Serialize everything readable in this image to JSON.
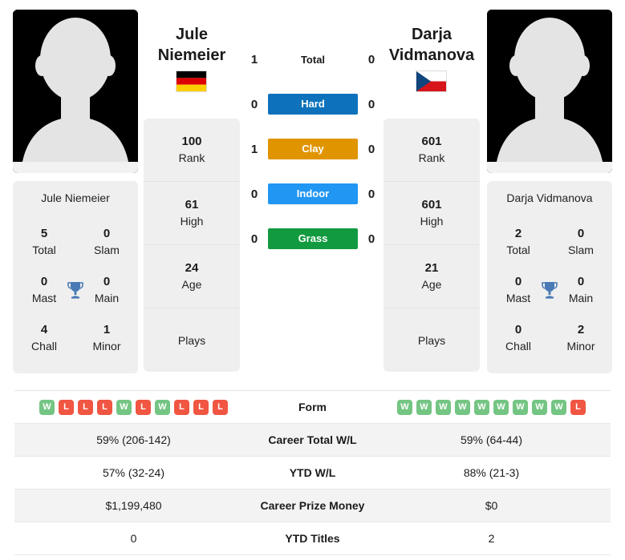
{
  "players": {
    "left": {
      "first_name": "Jule",
      "last_name": "Niemeier",
      "full_name": "Jule Niemeier",
      "country": "Germany",
      "flag_icon": "flag-germany-icon",
      "avatar_icon": "avatar-placeholder-icon",
      "rank": "100",
      "rank_label": "Rank",
      "high": "61",
      "high_label": "High",
      "age": "24",
      "age_label": "Age",
      "plays": "",
      "plays_label": "Plays",
      "titles": {
        "total": "5",
        "total_label": "Total",
        "slam": "0",
        "slam_label": "Slam",
        "mast": "0",
        "mast_label": "Mast",
        "main": "0",
        "main_label": "Main",
        "chall": "4",
        "chall_label": "Chall",
        "minor": "1",
        "minor_label": "Minor"
      },
      "form": [
        "W",
        "L",
        "L",
        "L",
        "W",
        "L",
        "W",
        "L",
        "L",
        "L"
      ]
    },
    "right": {
      "first_name": "Darja",
      "last_name": "Vidmanova",
      "full_name": "Darja Vidmanova",
      "country": "Czech Republic",
      "flag_icon": "flag-czech-republic-icon",
      "avatar_icon": "avatar-placeholder-icon",
      "rank": "601",
      "rank_label": "Rank",
      "high": "601",
      "high_label": "High",
      "age": "21",
      "age_label": "Age",
      "plays": "",
      "plays_label": "Plays",
      "titles": {
        "total": "2",
        "total_label": "Total",
        "slam": "0",
        "slam_label": "Slam",
        "mast": "0",
        "mast_label": "Mast",
        "main": "0",
        "main_label": "Main",
        "chall": "0",
        "chall_label": "Chall",
        "minor": "2",
        "minor_label": "Minor"
      },
      "form": [
        "W",
        "W",
        "W",
        "W",
        "W",
        "W",
        "W",
        "W",
        "W",
        "L"
      ]
    }
  },
  "h2h": [
    {
      "label": "Total",
      "left": "1",
      "right": "0",
      "style": "plain",
      "color": ""
    },
    {
      "label": "Hard",
      "left": "0",
      "right": "0",
      "style": "bar",
      "color": "#0d72bb"
    },
    {
      "label": "Clay",
      "left": "1",
      "right": "0",
      "style": "bar",
      "color": "#e09400"
    },
    {
      "label": "Indoor",
      "left": "0",
      "right": "0",
      "style": "bar",
      "color": "#2196f3"
    },
    {
      "label": "Grass",
      "left": "0",
      "right": "0",
      "style": "bar",
      "color": "#119a3f"
    }
  ],
  "stats_table": {
    "form_label": "Form",
    "rows": [
      {
        "label": "Career Total W/L",
        "left": "59% (206-142)",
        "right": "59% (64-44)"
      },
      {
        "label": "YTD W/L",
        "left": "57% (32-24)",
        "right": "88% (21-3)"
      },
      {
        "label": "Career Prize Money",
        "left": "$1,199,480",
        "right": "$0"
      },
      {
        "label": "YTD Titles",
        "left": "0",
        "right": "2"
      }
    ]
  },
  "colors": {
    "hard": "#0d72bb",
    "clay": "#e09400",
    "indoor": "#2196f3",
    "grass": "#119a3f",
    "win_badge": "#74c583",
    "loss_badge": "#f05642",
    "trophy": "#4a7ab5",
    "card_bg": "#efefef"
  }
}
